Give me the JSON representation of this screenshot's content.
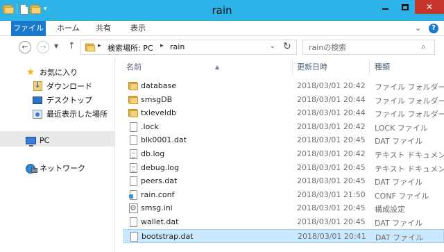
{
  "window": {
    "title": "rain",
    "controls": {
      "minimize": "minimize",
      "maximize": "maximize",
      "close": "close"
    }
  },
  "ribbon": {
    "tabs": [
      {
        "label": "ファイル",
        "active": true
      },
      {
        "label": "ホーム",
        "active": false
      },
      {
        "label": "共有",
        "active": false
      },
      {
        "label": "表示",
        "active": false
      }
    ]
  },
  "address": {
    "breadcrumb": [
      "検索場所: PC",
      "rain"
    ],
    "search_placeholder": "rainの検索"
  },
  "navigation": {
    "favorites_label": "お気に入り",
    "favorites": [
      {
        "label": "ダウンロード",
        "icon": "download-folder-icon"
      },
      {
        "label": "デスクトップ",
        "icon": "desktop-icon"
      },
      {
        "label": "最近表示した場所",
        "icon": "recent-places-icon"
      }
    ],
    "pc_label": "PC",
    "network_label": "ネットワーク",
    "selected": "PC"
  },
  "columns": {
    "name": "名前",
    "date": "更新日時",
    "type": "種類",
    "sort": "name-ascending"
  },
  "files": [
    {
      "name": "database",
      "date": "2018/03/01 20:42",
      "type": "ファイル フォルダー",
      "icon": "folder"
    },
    {
      "name": "smsgDB",
      "date": "2018/03/01 20:44",
      "type": "ファイル フォルダー",
      "icon": "folder"
    },
    {
      "name": "txleveldb",
      "date": "2018/03/01 20:44",
      "type": "ファイル フォルダー",
      "icon": "folder"
    },
    {
      "name": ".lock",
      "date": "2018/03/01 20:42",
      "type": "LOCK ファイル",
      "icon": "file"
    },
    {
      "name": "blk0001.dat",
      "date": "2018/03/01 20:45",
      "type": "DAT ファイル",
      "icon": "file"
    },
    {
      "name": "db.log",
      "date": "2018/03/01 20:42",
      "type": "テキスト ドキュメント",
      "icon": "text"
    },
    {
      "name": "debug.log",
      "date": "2018/03/01 20:45",
      "type": "テキスト ドキュメント",
      "icon": "text"
    },
    {
      "name": "peers.dat",
      "date": "2018/03/01 20:45",
      "type": "DAT ファイル",
      "icon": "file"
    },
    {
      "name": "rain.conf",
      "date": "2018/03/01 21:50",
      "type": "CONF ファイル",
      "icon": "conf"
    },
    {
      "name": "smsg.ini",
      "date": "2018/03/01 20:45",
      "type": "構成設定",
      "icon": "settings"
    },
    {
      "name": "wallet.dat",
      "date": "2018/03/01 20:45",
      "type": "DAT ファイル",
      "icon": "file"
    },
    {
      "name": "bootstrap.dat",
      "date": "2018/03/01 20:41",
      "type": "DAT ファイル",
      "icon": "file",
      "selected": true
    }
  ],
  "colors": {
    "titlebar": "#2db3e8",
    "file_tab": "#1979ca",
    "close": "#c7362d",
    "selection": "#cce8ff"
  }
}
